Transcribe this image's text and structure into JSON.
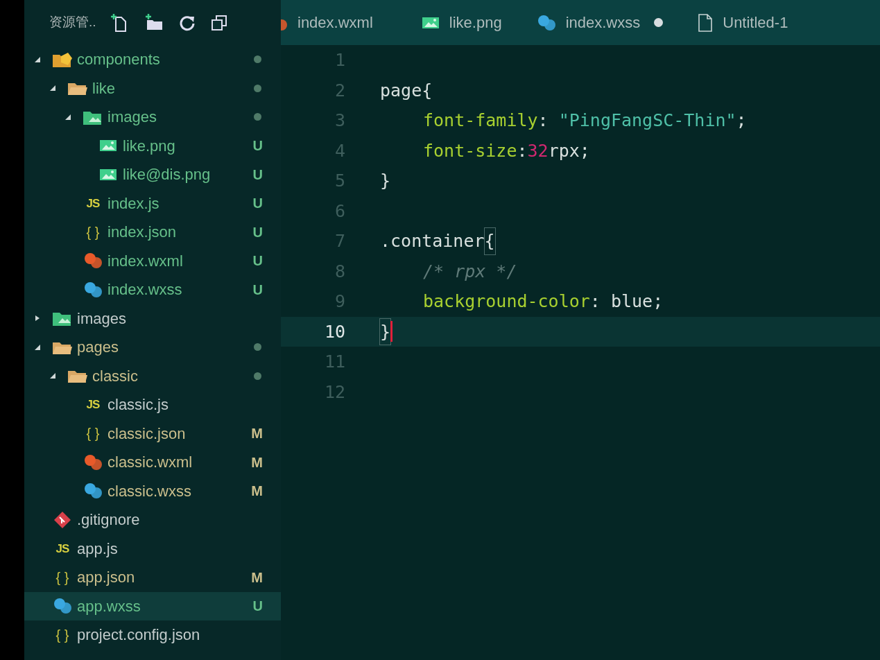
{
  "explorer": {
    "title": "资源管..",
    "tree": [
      {
        "name": "components",
        "kind": "components-folder",
        "expanded": true,
        "color": "#66c08a",
        "dot": true,
        "children": [
          {
            "name": "like",
            "kind": "folder",
            "expanded": true,
            "color": "#66c08a",
            "dot": true,
            "children": [
              {
                "name": "images",
                "kind": "image-folder",
                "expanded": true,
                "color": "#66c08a",
                "dot": true,
                "children": [
                  {
                    "name": "like.png",
                    "kind": "image",
                    "color": "#66c08a",
                    "status": "U",
                    "selected": false
                  },
                  {
                    "name": "like@dis.png",
                    "kind": "image",
                    "color": "#66c08a",
                    "status": "U",
                    "selected": false
                  }
                ]
              },
              {
                "name": "index.js",
                "kind": "js",
                "glyph": "JS",
                "color": "#66c08a",
                "status": "U",
                "selected": false
              },
              {
                "name": "index.json",
                "kind": "json",
                "glyph": "{ }",
                "color": "#66c08a",
                "status": "U",
                "selected": false
              },
              {
                "name": "index.wxml",
                "kind": "wxml",
                "color": "#66c08a",
                "status": "U",
                "selected": false
              },
              {
                "name": "index.wxss",
                "kind": "wxss",
                "color": "#66c08a",
                "status": "U",
                "selected": false
              }
            ]
          }
        ]
      },
      {
        "name": "images",
        "kind": "image-folder",
        "expanded": false,
        "color": "#c3cccc",
        "dot": false
      },
      {
        "name": "pages",
        "kind": "folder",
        "expanded": true,
        "color": "#cbbf8c",
        "dot": true,
        "children": [
          {
            "name": "classic",
            "kind": "folder",
            "expanded": true,
            "color": "#cbbf8c",
            "dot": true,
            "children": [
              {
                "name": "classic.js",
                "kind": "js",
                "glyph": "JS",
                "color": "#c3cccc",
                "selected": false
              },
              {
                "name": "classic.json",
                "kind": "json",
                "glyph": "{ }",
                "color": "#cbbf8c",
                "status": "M",
                "selected": false
              },
              {
                "name": "classic.wxml",
                "kind": "wxml",
                "color": "#cbbf8c",
                "status": "M",
                "selected": false
              },
              {
                "name": "classic.wxss",
                "kind": "wxss",
                "color": "#cbbf8c",
                "status": "M",
                "selected": false
              }
            ]
          }
        ]
      },
      {
        "name": ".gitignore",
        "kind": "git",
        "color": "#c3cccc",
        "selected": false
      },
      {
        "name": "app.js",
        "kind": "js",
        "glyph": "JS",
        "color": "#c3cccc",
        "selected": false
      },
      {
        "name": "app.json",
        "kind": "json",
        "glyph": "{ }",
        "color": "#cbbf8c",
        "status": "M",
        "selected": false
      },
      {
        "name": "app.wxss",
        "kind": "wxss",
        "color": "#66c08a",
        "status": "U",
        "selected": true
      },
      {
        "name": "project.config.json",
        "kind": "json",
        "glyph": "{ }",
        "color": "#c3cccc",
        "selected": false
      }
    ]
  },
  "tabs": [
    {
      "label": "index.wxml",
      "kind": "wxml",
      "dirty": false
    },
    {
      "label": "like.png",
      "kind": "image",
      "dirty": false
    },
    {
      "label": "index.wxss",
      "kind": "wxss",
      "dirty": true
    },
    {
      "label": "Untitled-1",
      "kind": "file",
      "dirty": false
    }
  ],
  "editor": {
    "lines": [
      {
        "number": "1",
        "current": false
      },
      {
        "number": "2",
        "current": false,
        "tokens": [
          {
            "kind": "selector",
            "text": "page{"
          }
        ]
      },
      {
        "number": "3",
        "current": false,
        "indented": true,
        "tokens": [
          {
            "kind": "property",
            "text": "font-family"
          },
          {
            "kind": "plain",
            "text": ": "
          },
          {
            "kind": "string",
            "text": "\"PingFangSC-Thin\""
          },
          {
            "kind": "plain",
            "text": ";"
          }
        ]
      },
      {
        "number": "4",
        "current": false,
        "indented": true,
        "tokens": [
          {
            "kind": "property",
            "text": "font-size"
          },
          {
            "kind": "plain",
            "text": ":"
          },
          {
            "kind": "number",
            "text": "32"
          },
          {
            "kind": "plain",
            "text": "rpx;"
          }
        ]
      },
      {
        "number": "5",
        "current": false,
        "tokens": [
          {
            "kind": "plain",
            "text": "}"
          }
        ]
      },
      {
        "number": "6",
        "current": false
      },
      {
        "number": "7",
        "current": false,
        "tokens": [
          {
            "kind": "selector",
            "text": ".container"
          },
          {
            "kind": "bracket",
            "text": "{"
          }
        ]
      },
      {
        "number": "8",
        "current": false,
        "indented": true,
        "tokens": [
          {
            "kind": "comment",
            "text": "/* rpx */"
          }
        ]
      },
      {
        "number": "9",
        "current": false,
        "indented": true,
        "tokens": [
          {
            "kind": "property",
            "text": "background-color"
          },
          {
            "kind": "plain",
            "text": ": blue;"
          }
        ]
      },
      {
        "number": "10",
        "current": true,
        "tokens": [
          {
            "kind": "bracket",
            "text": "}"
          }
        ]
      },
      {
        "number": "11",
        "current": false
      },
      {
        "number": "12",
        "current": false
      }
    ]
  }
}
